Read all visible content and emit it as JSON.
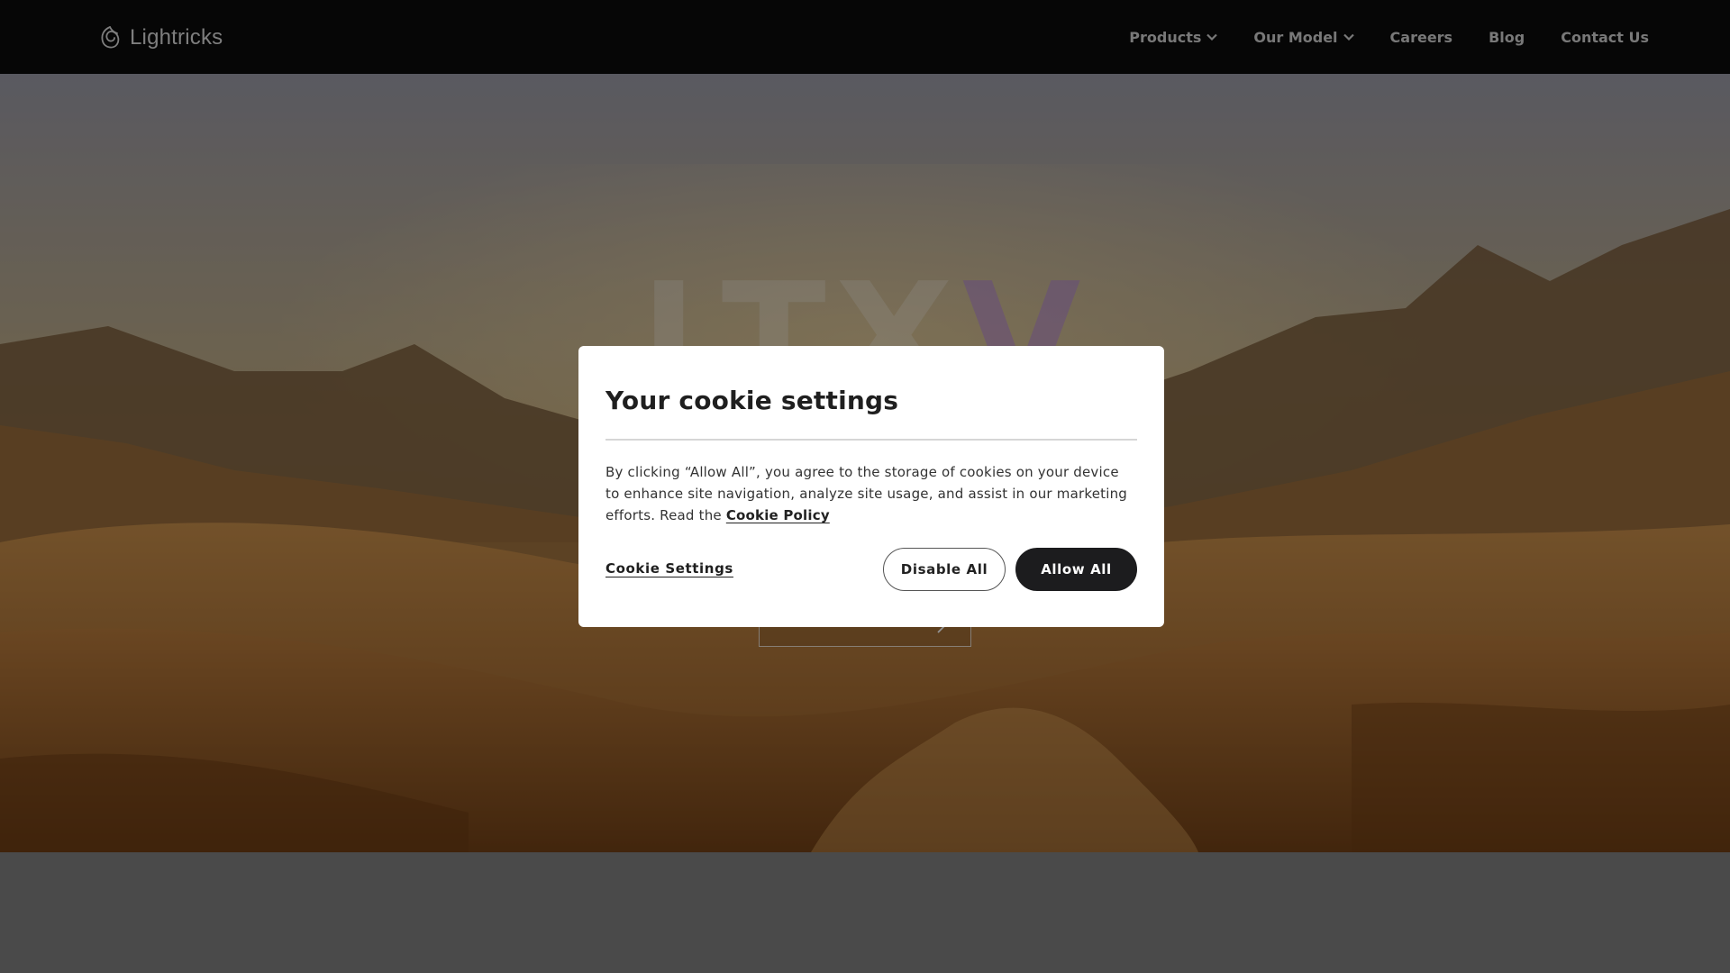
{
  "header": {
    "logo_text": "Lightricks",
    "nav": [
      {
        "label": "Products",
        "has_dropdown": true
      },
      {
        "label": "Our Model",
        "has_dropdown": true
      },
      {
        "label": "Careers",
        "has_dropdown": false
      },
      {
        "label": "Blog",
        "has_dropdown": false
      },
      {
        "label": "Contact Us",
        "has_dropdown": false
      }
    ]
  },
  "hero": {
    "wordmark_main": "LTX",
    "wordmark_accent": "V"
  },
  "cookie_dialog": {
    "title": "Your cookie settings",
    "body_text": "By clicking “Allow All”, you agree to the storage of cookies on your device to enhance site navigation, analyze site usage, and assist in our marketing efforts. Read the ",
    "policy_link": "Cookie Policy",
    "settings_link": "Cookie Settings",
    "disable_button": "Disable All",
    "allow_button": "Allow All"
  },
  "colors": {
    "header_bg": "#0b0b0b",
    "dialog_bg": "#ffffff",
    "allow_button_bg": "#1c1c1e",
    "overlay": "rgba(0,0,0,0.42)",
    "page_bottom": "#808080"
  },
  "icons": {
    "logo": "lightricks-logo-icon",
    "dropdown": "chevron-down-icon",
    "cta_arrow": "arrow-right-icon"
  }
}
